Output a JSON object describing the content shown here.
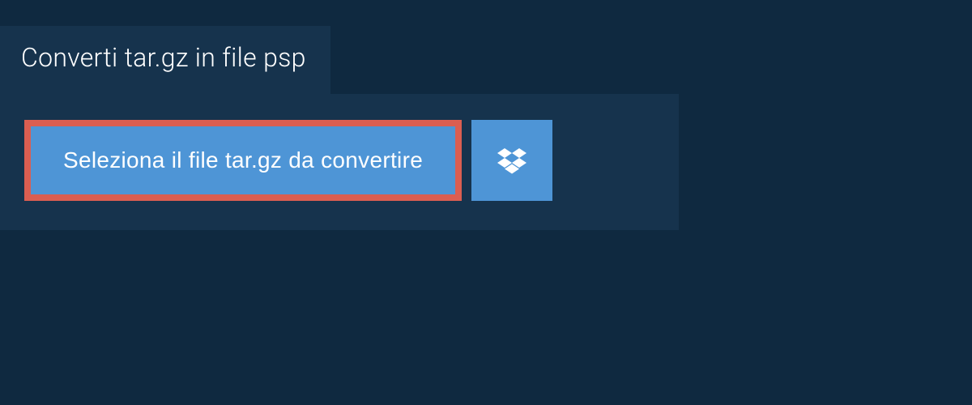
{
  "tab": {
    "title": "Converti tar.gz in file psp"
  },
  "buttons": {
    "select_file_label": "Seleziona il file tar.gz da convertire"
  }
}
